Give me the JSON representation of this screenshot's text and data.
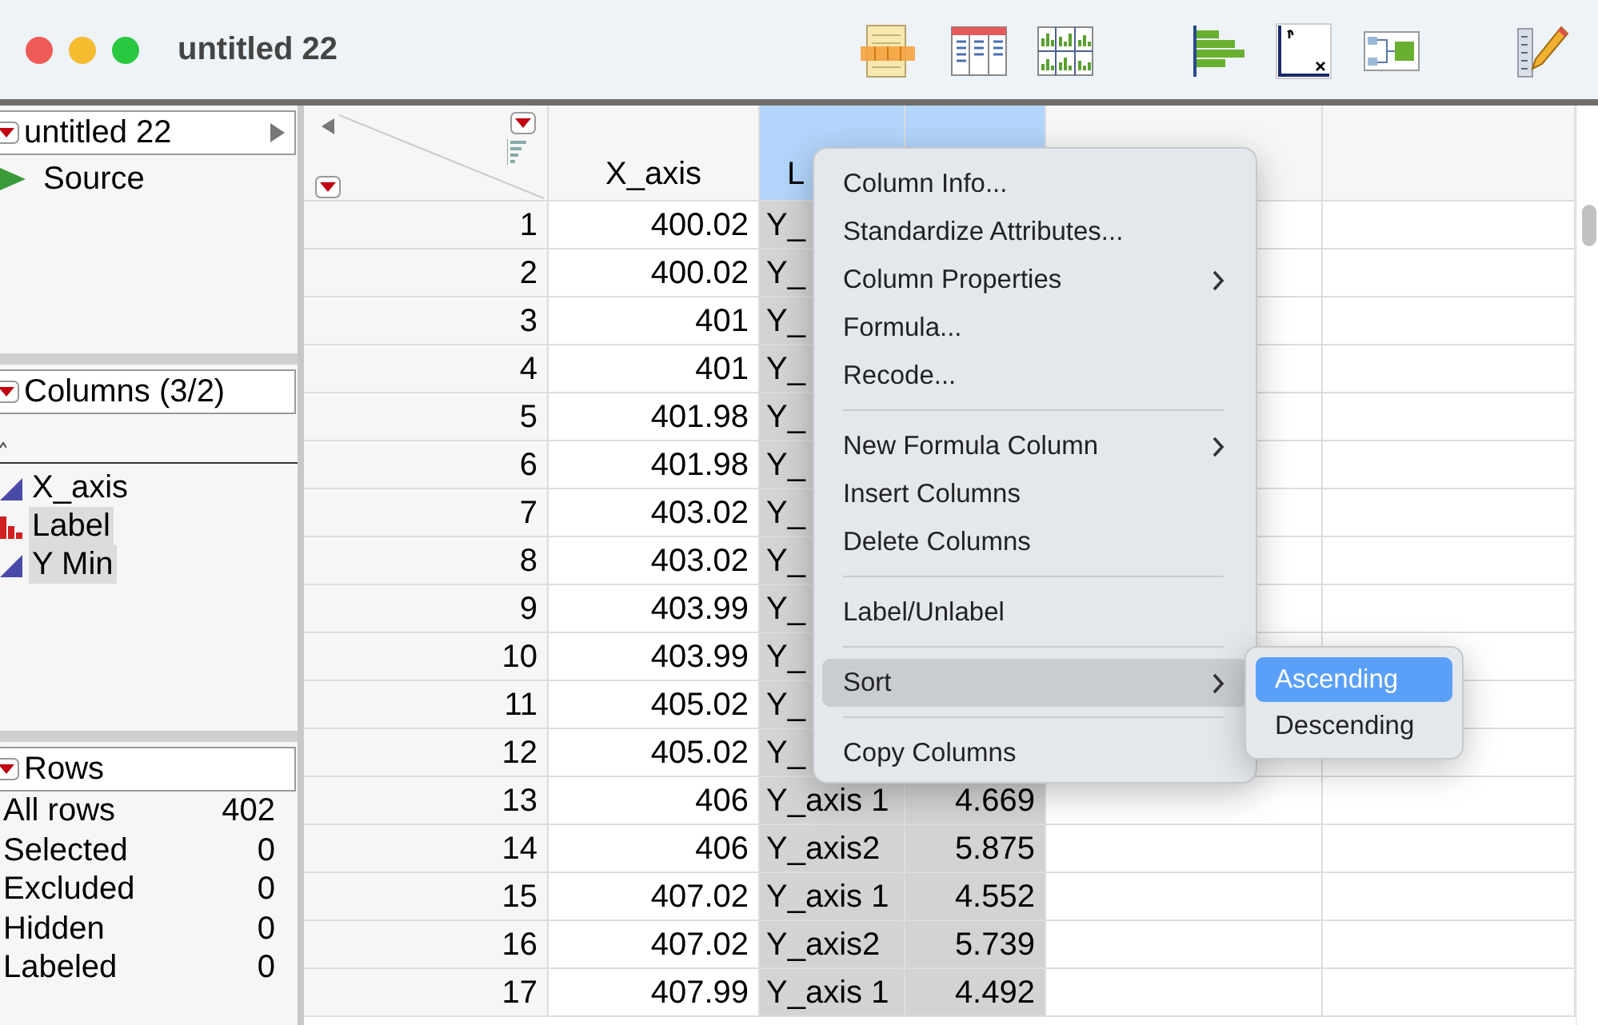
{
  "window": {
    "title": "untitled 22"
  },
  "toolbar": [
    {
      "kind": "spreadsheet"
    },
    {
      "kind": "table"
    },
    {
      "kind": "grid"
    },
    {
      "kind": "bars"
    },
    {
      "kind": "axes"
    },
    {
      "kind": "diagram"
    },
    {
      "kind": "pencil"
    }
  ],
  "table_panel": {
    "title": "untitled 22",
    "items": [
      "Source"
    ]
  },
  "columns_panel": {
    "title": "Columns (3/2)",
    "items": [
      {
        "name": "X_axis",
        "kind": "continuous",
        "selected": false
      },
      {
        "name": "Label",
        "kind": "nominal",
        "selected": true
      },
      {
        "name": "Y Min",
        "kind": "continuous",
        "selected": true
      }
    ]
  },
  "rows_panel": {
    "title": "Rows",
    "stats": [
      {
        "label": "All rows",
        "value": "402"
      },
      {
        "label": "Selected",
        "value": "0"
      },
      {
        "label": "Excluded",
        "value": "0"
      },
      {
        "label": "Hidden",
        "value": "0"
      },
      {
        "label": "Labeled",
        "value": "0"
      }
    ]
  },
  "table": {
    "columns": [
      {
        "heading": "X_axis",
        "selected": false
      },
      {
        "heading": "L",
        "selected": true
      },
      {
        "selected": true
      },
      {
        "selected": false
      },
      {
        "selected": false
      }
    ],
    "rows": [
      {
        "number": "1",
        "cells": [
          "400.02",
          "Y_"
        ]
      },
      {
        "number": "2",
        "cells": [
          "400.02",
          "Y_"
        ]
      },
      {
        "number": "3",
        "cells": [
          "401",
          "Y_"
        ]
      },
      {
        "number": "4",
        "cells": [
          "401",
          "Y_"
        ]
      },
      {
        "number": "5",
        "cells": [
          "401.98",
          "Y_"
        ]
      },
      {
        "number": "6",
        "cells": [
          "401.98",
          "Y_"
        ]
      },
      {
        "number": "7",
        "cells": [
          "403.02",
          "Y_"
        ]
      },
      {
        "number": "8",
        "cells": [
          "403.02",
          "Y_"
        ]
      },
      {
        "number": "9",
        "cells": [
          "403.99",
          "Y_"
        ]
      },
      {
        "number": "10",
        "cells": [
          "403.99",
          "Y_"
        ]
      },
      {
        "number": "11",
        "cells": [
          "405.02",
          "Y_"
        ]
      },
      {
        "number": "12",
        "cells": [
          "405.02",
          "Y_"
        ]
      },
      {
        "number": "13",
        "cells": [
          "406",
          "Y_axis 1",
          "4.669"
        ]
      },
      {
        "number": "14",
        "cells": [
          "406",
          "Y_axis2",
          "5.875"
        ]
      },
      {
        "number": "15",
        "cells": [
          "407.02",
          "Y_axis 1",
          "4.552"
        ]
      },
      {
        "number": "16",
        "cells": [
          "407.02",
          "Y_axis2",
          "5.739"
        ]
      },
      {
        "number": "17",
        "cells": [
          "407.99",
          "Y_axis 1",
          "4.492"
        ]
      }
    ]
  },
  "context_menu": {
    "items": [
      {
        "kind": "item",
        "label": "Column Info...",
        "highlighted": false
      },
      {
        "kind": "item",
        "label": "Standardize Attributes...",
        "highlighted": false
      },
      {
        "kind": "submenu",
        "label": "Column Properties",
        "highlighted": false
      },
      {
        "kind": "item",
        "label": "Formula...",
        "highlighted": false
      },
      {
        "kind": "item",
        "label": "Recode...",
        "highlighted": false
      },
      {
        "kind": "separator"
      },
      {
        "kind": "submenu",
        "label": "New Formula Column",
        "highlighted": false
      },
      {
        "kind": "item",
        "label": "Insert Columns",
        "highlighted": false
      },
      {
        "kind": "item",
        "label": "Delete Columns",
        "highlighted": false
      },
      {
        "kind": "separator"
      },
      {
        "kind": "item",
        "label": "Label/Unlabel",
        "highlighted": false
      },
      {
        "kind": "separator"
      },
      {
        "kind": "submenu",
        "label": "Sort",
        "highlighted": true
      },
      {
        "kind": "separator"
      },
      {
        "kind": "item",
        "label": "Copy Columns",
        "highlighted": false
      }
    ],
    "submenu": [
      {
        "label": "Ascending",
        "selected": true
      },
      {
        "label": "Descending",
        "selected": false
      }
    ]
  }
}
